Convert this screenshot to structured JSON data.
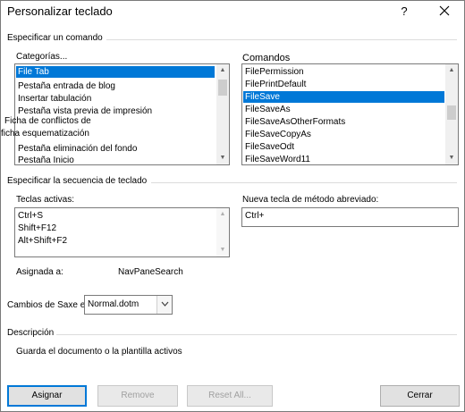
{
  "window": {
    "title": "Personalizar teclado",
    "help_label": "?"
  },
  "command_section": {
    "label": "Especificar un comando",
    "categories_label": "Categorías...",
    "categories": [
      "File Tab",
      "Pestaña entrada de blog",
      "Insertar tabulación",
      "Pestaña vista previa de impresión",
      "Pestaña eliminación del fondo",
      "Pestaña Inicio"
    ],
    "categories_selected_index": 0,
    "categories_overflow_text": [
      "Ficha de conflictos de",
      "ficha esquematización"
    ],
    "commands_label": "Comandos",
    "commands": [
      "FilePermission",
      "FilePrintDefault",
      "FileSave",
      "FileSaveAs",
      "FileSaveAsOtherFormats",
      "FileSaveCopyAs",
      "FileSaveOdt",
      "FileSaveWord11"
    ],
    "commands_selected_index": 2
  },
  "sequence_section": {
    "label": "Especificar la secuencia de teclado",
    "current_keys_label": "Teclas activas:",
    "current_keys": [
      "Ctrl+S",
      "Shift+F12",
      "Alt+Shift+F2"
    ],
    "new_key_label": "Nueva tecla de método abreviado:",
    "new_key_value": "Ctrl+",
    "assigned_to_label": "Asignada a:",
    "assigned_to_value": "NavPaneSearch",
    "save_changes_label": "Cambios de Saxe en",
    "save_changes_value": "Normal.dotm"
  },
  "description_section": {
    "label": "Descripción",
    "text": "Guarda el documento o la plantilla activos"
  },
  "buttons": {
    "assign": "Asignar",
    "remove": "Remove",
    "reset_all": "Reset All...",
    "close": "Cerrar"
  }
}
